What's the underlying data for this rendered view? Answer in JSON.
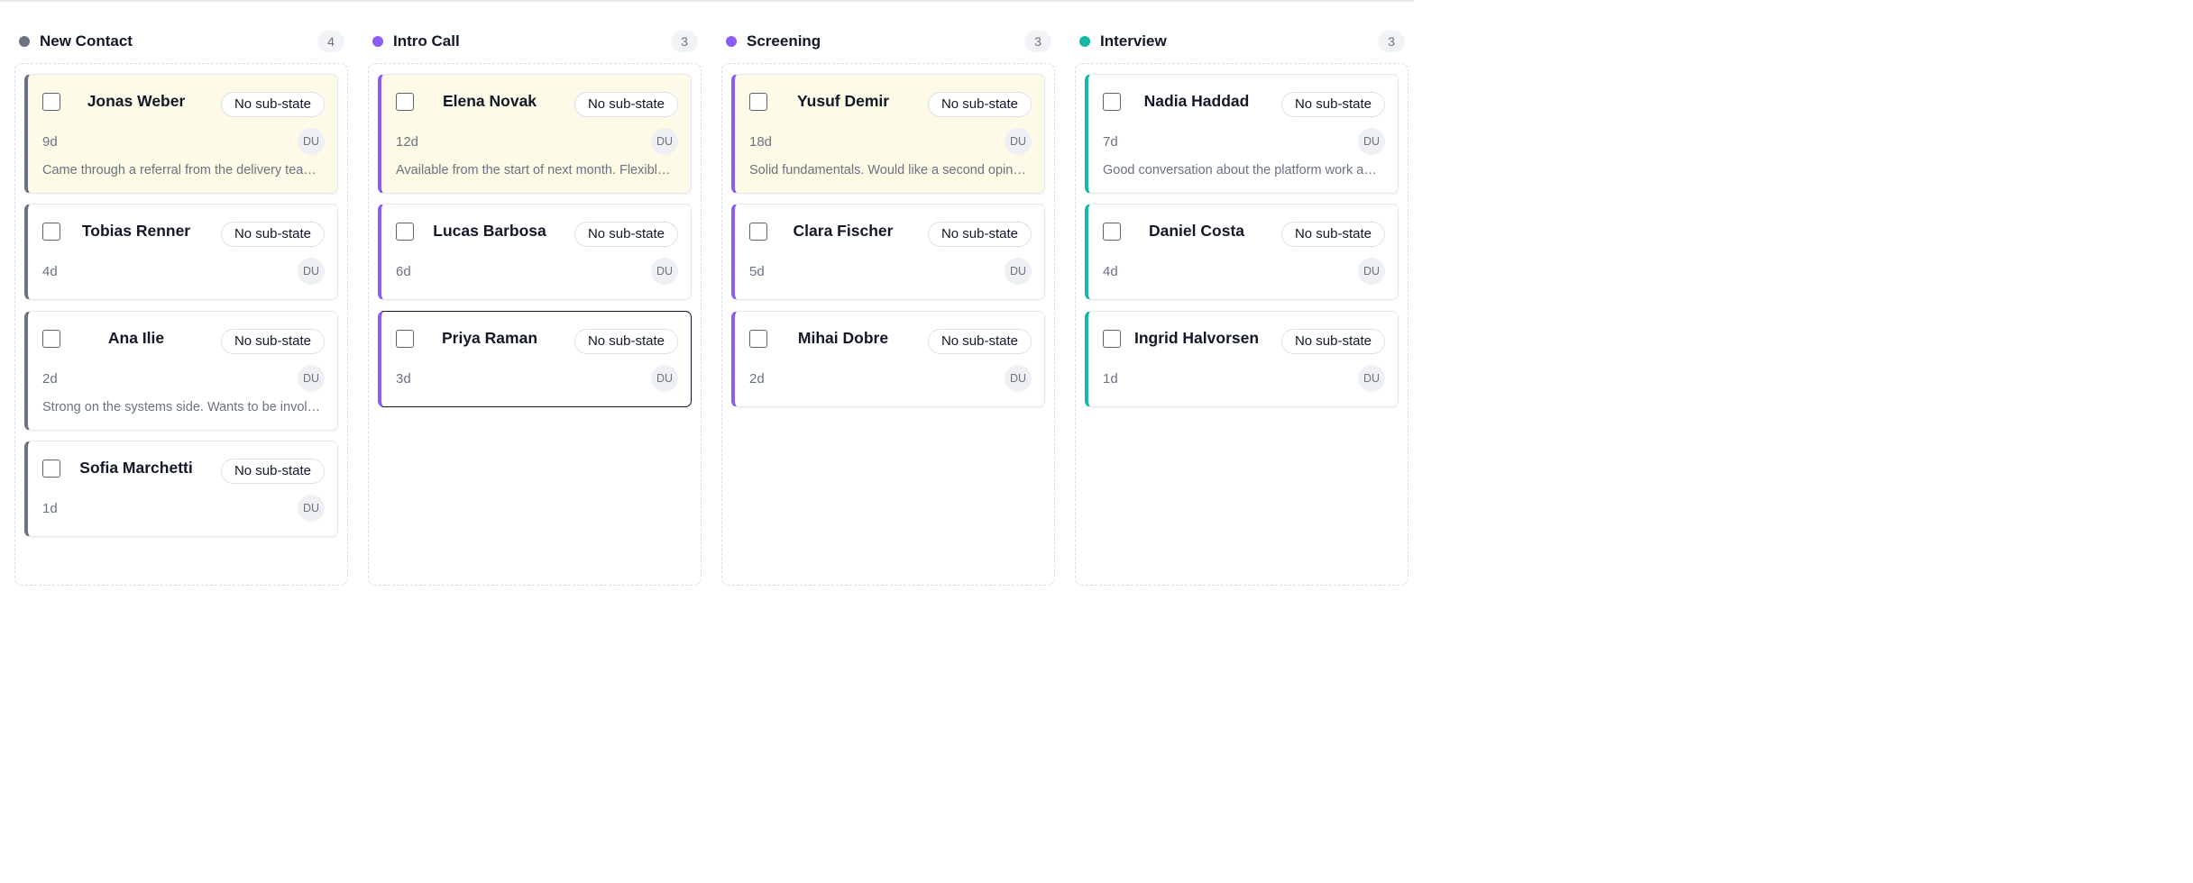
{
  "colors": {
    "gray": "#6b7280",
    "purple": "#8b5cf6",
    "teal": "#14b8a6",
    "highlight": "#fefae8"
  },
  "columns": [
    {
      "title": "New Contact",
      "count": "4",
      "color": "#6b7280",
      "cards": [
        {
          "name": "Jonas Weber",
          "substate": "No sub-state",
          "age": "9d",
          "avatar": "DU",
          "note": "Came through a referral from the delivery team. Strong background in distributed systems.",
          "highlighted": true,
          "selected": false
        },
        {
          "name": "Tobias Renner",
          "substate": "No sub-state",
          "age": "4d",
          "avatar": "DU",
          "note": "",
          "highlighted": false,
          "selected": false
        },
        {
          "name": "Ana Ilie",
          "substate": "No sub-state",
          "age": "2d",
          "avatar": "DU",
          "note": "Strong on the systems side. Wants to be involved in architecture decisions.",
          "highlighted": false,
          "selected": false
        },
        {
          "name": "Sofia Marchetti",
          "substate": "No sub-state",
          "age": "1d",
          "avatar": "DU",
          "note": "",
          "highlighted": false,
          "selected": false
        }
      ]
    },
    {
      "title": "Intro Call",
      "count": "3",
      "color": "#8b5cf6",
      "cards": [
        {
          "name": "Elena Novak",
          "substate": "No sub-state",
          "age": "12d",
          "avatar": "DU",
          "note": "Available from the start of next month. Flexible on remote arrangements.",
          "highlighted": true,
          "selected": false
        },
        {
          "name": "Lucas Barbosa",
          "substate": "No sub-state",
          "age": "6d",
          "avatar": "DU",
          "note": "",
          "highlighted": false,
          "selected": false
        },
        {
          "name": "Priya Raman",
          "substate": "No sub-state",
          "age": "3d",
          "avatar": "DU",
          "note": "",
          "highlighted": false,
          "selected": true
        }
      ]
    },
    {
      "title": "Screening",
      "count": "3",
      "color": "#8b5cf6",
      "cards": [
        {
          "name": "Yusuf Demir",
          "substate": "No sub-state",
          "age": "18d",
          "avatar": "DU",
          "note": "Solid fundamentals. Would like a second opinion from the platform team.",
          "highlighted": true,
          "selected": false
        },
        {
          "name": "Clara Fischer",
          "substate": "No sub-state",
          "age": "5d",
          "avatar": "DU",
          "note": "",
          "highlighted": false,
          "selected": false
        },
        {
          "name": "Mihai Dobre",
          "substate": "No sub-state",
          "age": "2d",
          "avatar": "DU",
          "note": "",
          "highlighted": false,
          "selected": false
        }
      ]
    },
    {
      "title": "Interview",
      "count": "3",
      "color": "#14b8a6",
      "cards": [
        {
          "name": "Nadia Haddad",
          "substate": "No sub-state",
          "age": "7d",
          "avatar": "DU",
          "note": "Good conversation about the platform work and on-call expectations.",
          "highlighted": false,
          "selected": false
        },
        {
          "name": "Daniel Costa",
          "substate": "No sub-state",
          "age": "4d",
          "avatar": "DU",
          "note": "",
          "highlighted": false,
          "selected": false
        },
        {
          "name": "Ingrid Halvorsen",
          "substate": "No sub-state",
          "age": "1d",
          "avatar": "DU",
          "note": "",
          "highlighted": false,
          "selected": false
        }
      ]
    }
  ]
}
